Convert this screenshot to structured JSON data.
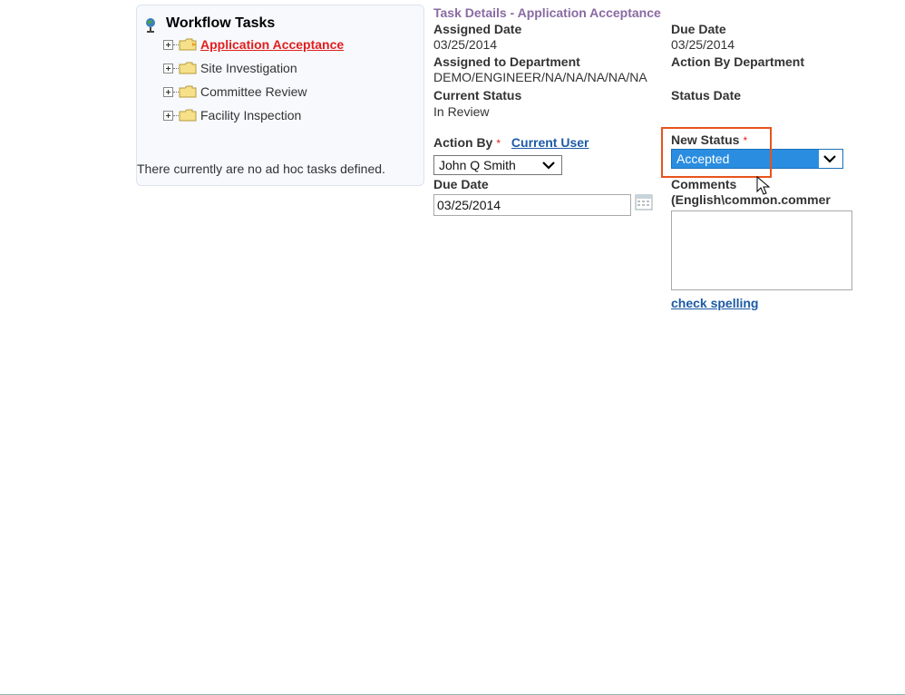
{
  "workflow": {
    "title": "Workflow Tasks",
    "title_icon": "globe-person-icon",
    "tasks": [
      {
        "label": "Application Acceptance",
        "active": true
      },
      {
        "label": "Site Investigation",
        "active": false
      },
      {
        "label": "Committee Review",
        "active": false
      },
      {
        "label": "Facility Inspection",
        "active": false
      }
    ],
    "adhoc_message": "There currently are no ad hoc tasks defined."
  },
  "task_details": {
    "title": "Task Details - Application Acceptance",
    "assigned_date_label": "Assigned Date",
    "assigned_date": "03/25/2014",
    "due_date_label": "Due Date",
    "due_date": "03/25/2014",
    "assigned_dept_label": "Assigned to Department",
    "assigned_dept": "DEMO/ENGINEER/NA/NA/NA/NA/NA",
    "action_by_dept_label": "Action By Department",
    "current_status_label": "Current Status",
    "current_status": "In Review",
    "status_date_label": "Status Date"
  },
  "form": {
    "action_by_label": "Action By",
    "required_mark": "*",
    "current_user_link": "Current User",
    "action_by_value": "John Q Smith",
    "due_date_label": "Due Date",
    "due_date_value": "03/25/2014",
    "new_status_label": "New Status",
    "new_status_value": "Accepted",
    "comments_label": "Comments",
    "comments_sublabel": "(English\\common.commer",
    "check_spelling_link": "check spelling"
  },
  "colors": {
    "active_task": "#e21e1e",
    "section_title": "#8a6aa3",
    "link": "#1c5aa6",
    "highlight_border": "#e8531c",
    "selected_option": "#2a8de0"
  }
}
